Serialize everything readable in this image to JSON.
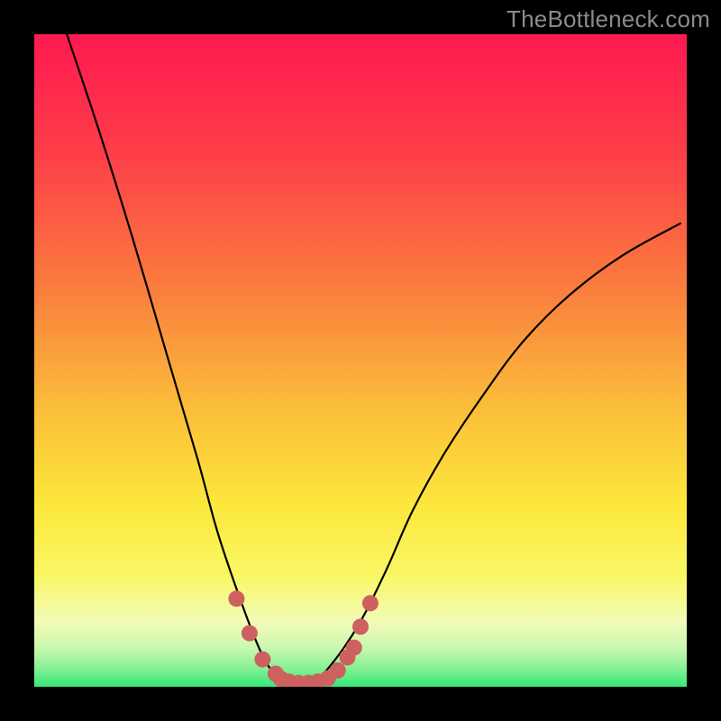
{
  "watermark": "TheBottleneck.com",
  "chart_data": {
    "type": "line",
    "title": "",
    "xlabel": "",
    "ylabel": "",
    "xlim": [
      0,
      100
    ],
    "ylim": [
      0,
      100
    ],
    "background_gradient": {
      "top": "#fe1950",
      "mid_upper": "#fa7a3e",
      "mid": "#fde73b",
      "mid_lower": "#f7f99f",
      "bottom": "#35e979"
    },
    "series": [
      {
        "name": "bottleneck-curve",
        "x": [
          5,
          10,
          15,
          20,
          25,
          28,
          31,
          34,
          36,
          38,
          40,
          43,
          46,
          50,
          54,
          58,
          63,
          69,
          75,
          82,
          90,
          99
        ],
        "y": [
          100,
          85,
          69,
          52,
          35,
          24,
          15,
          7,
          3,
          1,
          0.5,
          1,
          4,
          10,
          18,
          27,
          36,
          45,
          53,
          60,
          66,
          71
        ]
      }
    ],
    "highlight_points": {
      "name": "bottleneck-markers",
      "color": "#cf6060",
      "x": [
        31.0,
        33.0,
        35.0,
        37.0,
        37.8,
        39.0,
        40.5,
        42.0,
        43.5,
        45.0,
        46.5,
        48.0,
        49.0,
        50.0,
        51.5
      ],
      "y": [
        13.5,
        8.2,
        4.2,
        2.0,
        1.2,
        0.8,
        0.6,
        0.6,
        0.8,
        1.3,
        2.5,
        4.5,
        6.0,
        9.2,
        12.8
      ]
    }
  }
}
